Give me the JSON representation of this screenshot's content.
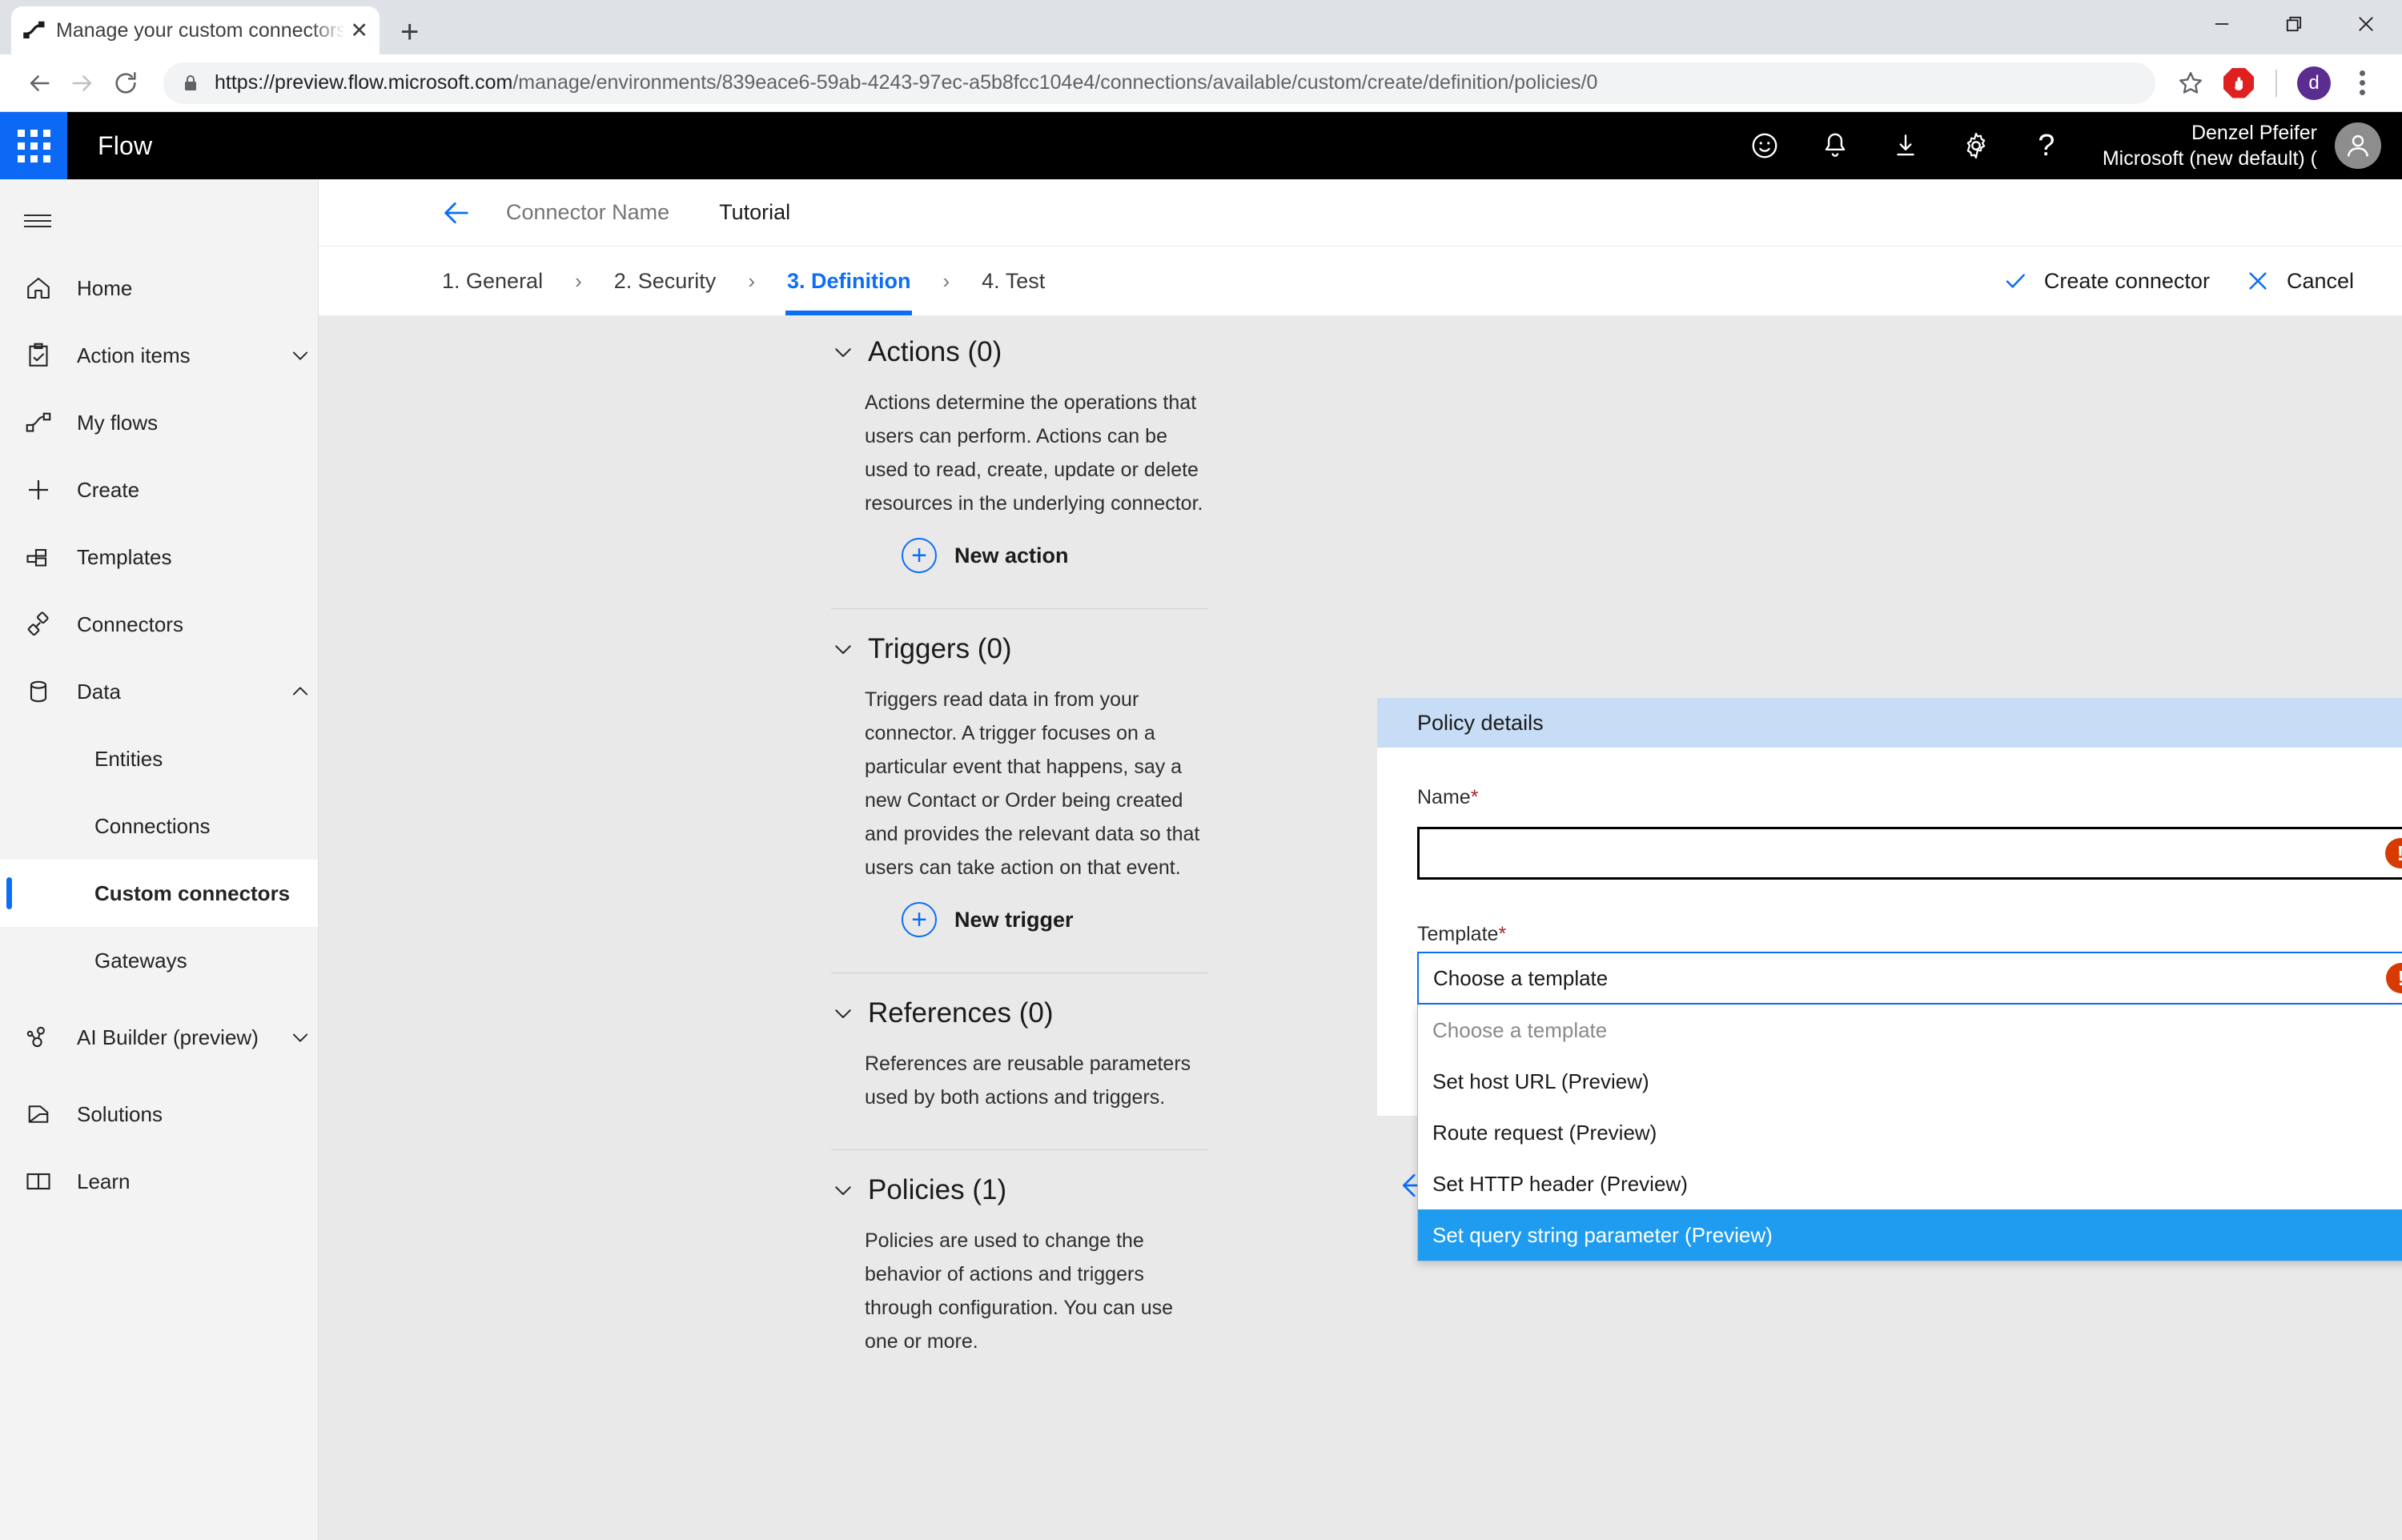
{
  "browser": {
    "tab": {
      "title": "Manage your custom connectors",
      "favicon": "flow-favicon",
      "close_label": "✕"
    },
    "new_tab_label": "+",
    "window_controls": {
      "minimize": "—",
      "maximize": "❐",
      "close": "✕"
    },
    "url_scheme_host": "https://preview.flow.microsoft.com",
    "url_path": "/manage/environments/839eace6-59ab-4243-97ec-a5b8fcc104e4/connections/available/custom/create/definition/policies/0",
    "icons": {
      "back": "back-arrow-icon",
      "forward": "forward-arrow-icon",
      "reload": "reload-icon",
      "lock": "lock-icon",
      "bookmark": "star-icon",
      "adblock": "adblock-icon",
      "menu": "three-dot-menu-icon"
    },
    "profile_initial": "d"
  },
  "appbar": {
    "waffle": "app-launcher-icon",
    "brand": "Flow",
    "icons": [
      {
        "name": "feedback-smiley-icon",
        "glyph": "☺"
      },
      {
        "name": "notifications-bell-icon",
        "glyph": "🔔"
      },
      {
        "name": "download-icon",
        "glyph": "↓"
      },
      {
        "name": "settings-gear-icon",
        "glyph": "⚙"
      },
      {
        "name": "help-question-icon",
        "glyph": "?"
      }
    ],
    "user_name": "Denzel Pfeifer",
    "user_org": "Microsoft (new default) ("
  },
  "sidebar": {
    "hamburger": "hamburger-menu-icon",
    "items": [
      {
        "label": "Home",
        "icon": "home-icon",
        "type": "item",
        "chevron": ""
      },
      {
        "label": "Action items",
        "icon": "clipboard-check-icon",
        "type": "item",
        "chevron": "down"
      },
      {
        "label": "My flows",
        "icon": "flow-icon",
        "type": "item",
        "chevron": ""
      },
      {
        "label": "Create",
        "icon": "plus-icon",
        "type": "item",
        "chevron": ""
      },
      {
        "label": "Templates",
        "icon": "templates-icon",
        "type": "item",
        "chevron": ""
      },
      {
        "label": "Connectors",
        "icon": "connectors-plug-icon",
        "type": "item",
        "chevron": ""
      },
      {
        "label": "Data",
        "icon": "database-icon",
        "type": "item",
        "chevron": "up"
      },
      {
        "label": "Entities",
        "icon": "",
        "type": "sub",
        "chevron": ""
      },
      {
        "label": "Connections",
        "icon": "",
        "type": "sub",
        "chevron": ""
      },
      {
        "label": "Custom connectors",
        "icon": "",
        "type": "sub",
        "selected": true,
        "chevron": ""
      },
      {
        "label": "Gateways",
        "icon": "",
        "type": "sub",
        "chevron": ""
      },
      {
        "label": "AI Builder (preview)",
        "icon": "ai-builder-icon",
        "type": "item-tall",
        "chevron": "down"
      },
      {
        "label": "Solutions",
        "icon": "solutions-icon",
        "type": "item",
        "chevron": ""
      },
      {
        "label": "Learn",
        "icon": "book-icon",
        "type": "item",
        "chevron": ""
      }
    ]
  },
  "breadcrumb": {
    "back_icon": "back-arrow-icon",
    "connector_name": "Connector Name",
    "current": "Tutorial"
  },
  "wizard": {
    "steps": [
      {
        "label": "1. General",
        "active": false
      },
      {
        "label": "2. Security",
        "active": false
      },
      {
        "label": "3. Definition",
        "active": true
      },
      {
        "label": "4. Test",
        "active": false
      }
    ],
    "separator": "›",
    "create_label": "Create connector",
    "cancel_label": "Cancel"
  },
  "definition": {
    "sections": [
      {
        "title": "Actions (0)",
        "desc": "Actions determine the operations that users can perform. Actions can be used to read, create, update or delete resources in the underlying connector.",
        "button": "New action"
      },
      {
        "title": "Triggers (0)",
        "desc": "Triggers read data in from your connector. A trigger focuses on a particular event that happens, say a new Contact or Order being created and provides the relevant data so that users can take action on that event.",
        "button": "New trigger"
      },
      {
        "title": "References (0)",
        "desc": "References are reusable parameters used by both actions and triggers.",
        "button": ""
      },
      {
        "title": "Policies (1)",
        "desc": "Policies are used to change the behavior of actions and triggers through configuration. You can use one or more.",
        "button": ""
      }
    ]
  },
  "policy_panel": {
    "header": "Policy details",
    "name_label": "Name",
    "name_value": "",
    "required_marker": "*",
    "template_label": "Template",
    "template_value": "Choose a template",
    "error_glyph": "!",
    "options": [
      {
        "label": "Choose a template",
        "placeholder": true,
        "selected": false
      },
      {
        "label": "Set host URL (Preview)",
        "placeholder": false,
        "selected": false
      },
      {
        "label": "Route request (Preview)",
        "placeholder": false,
        "selected": false
      },
      {
        "label": "Set HTTP header (Preview)",
        "placeholder": false,
        "selected": false
      },
      {
        "label": "Set query string parameter (Preview)",
        "placeholder": false,
        "selected": true
      }
    ],
    "pager_prev": "previous-policy-arrow",
    "pager_next": "next-policy-arrow"
  },
  "colors": {
    "accent": "#0b6ef5",
    "panel_header": "#c7dcf5",
    "selected_option": "#1f9cf0",
    "error": "#d83b01",
    "appbar": "#000000"
  }
}
